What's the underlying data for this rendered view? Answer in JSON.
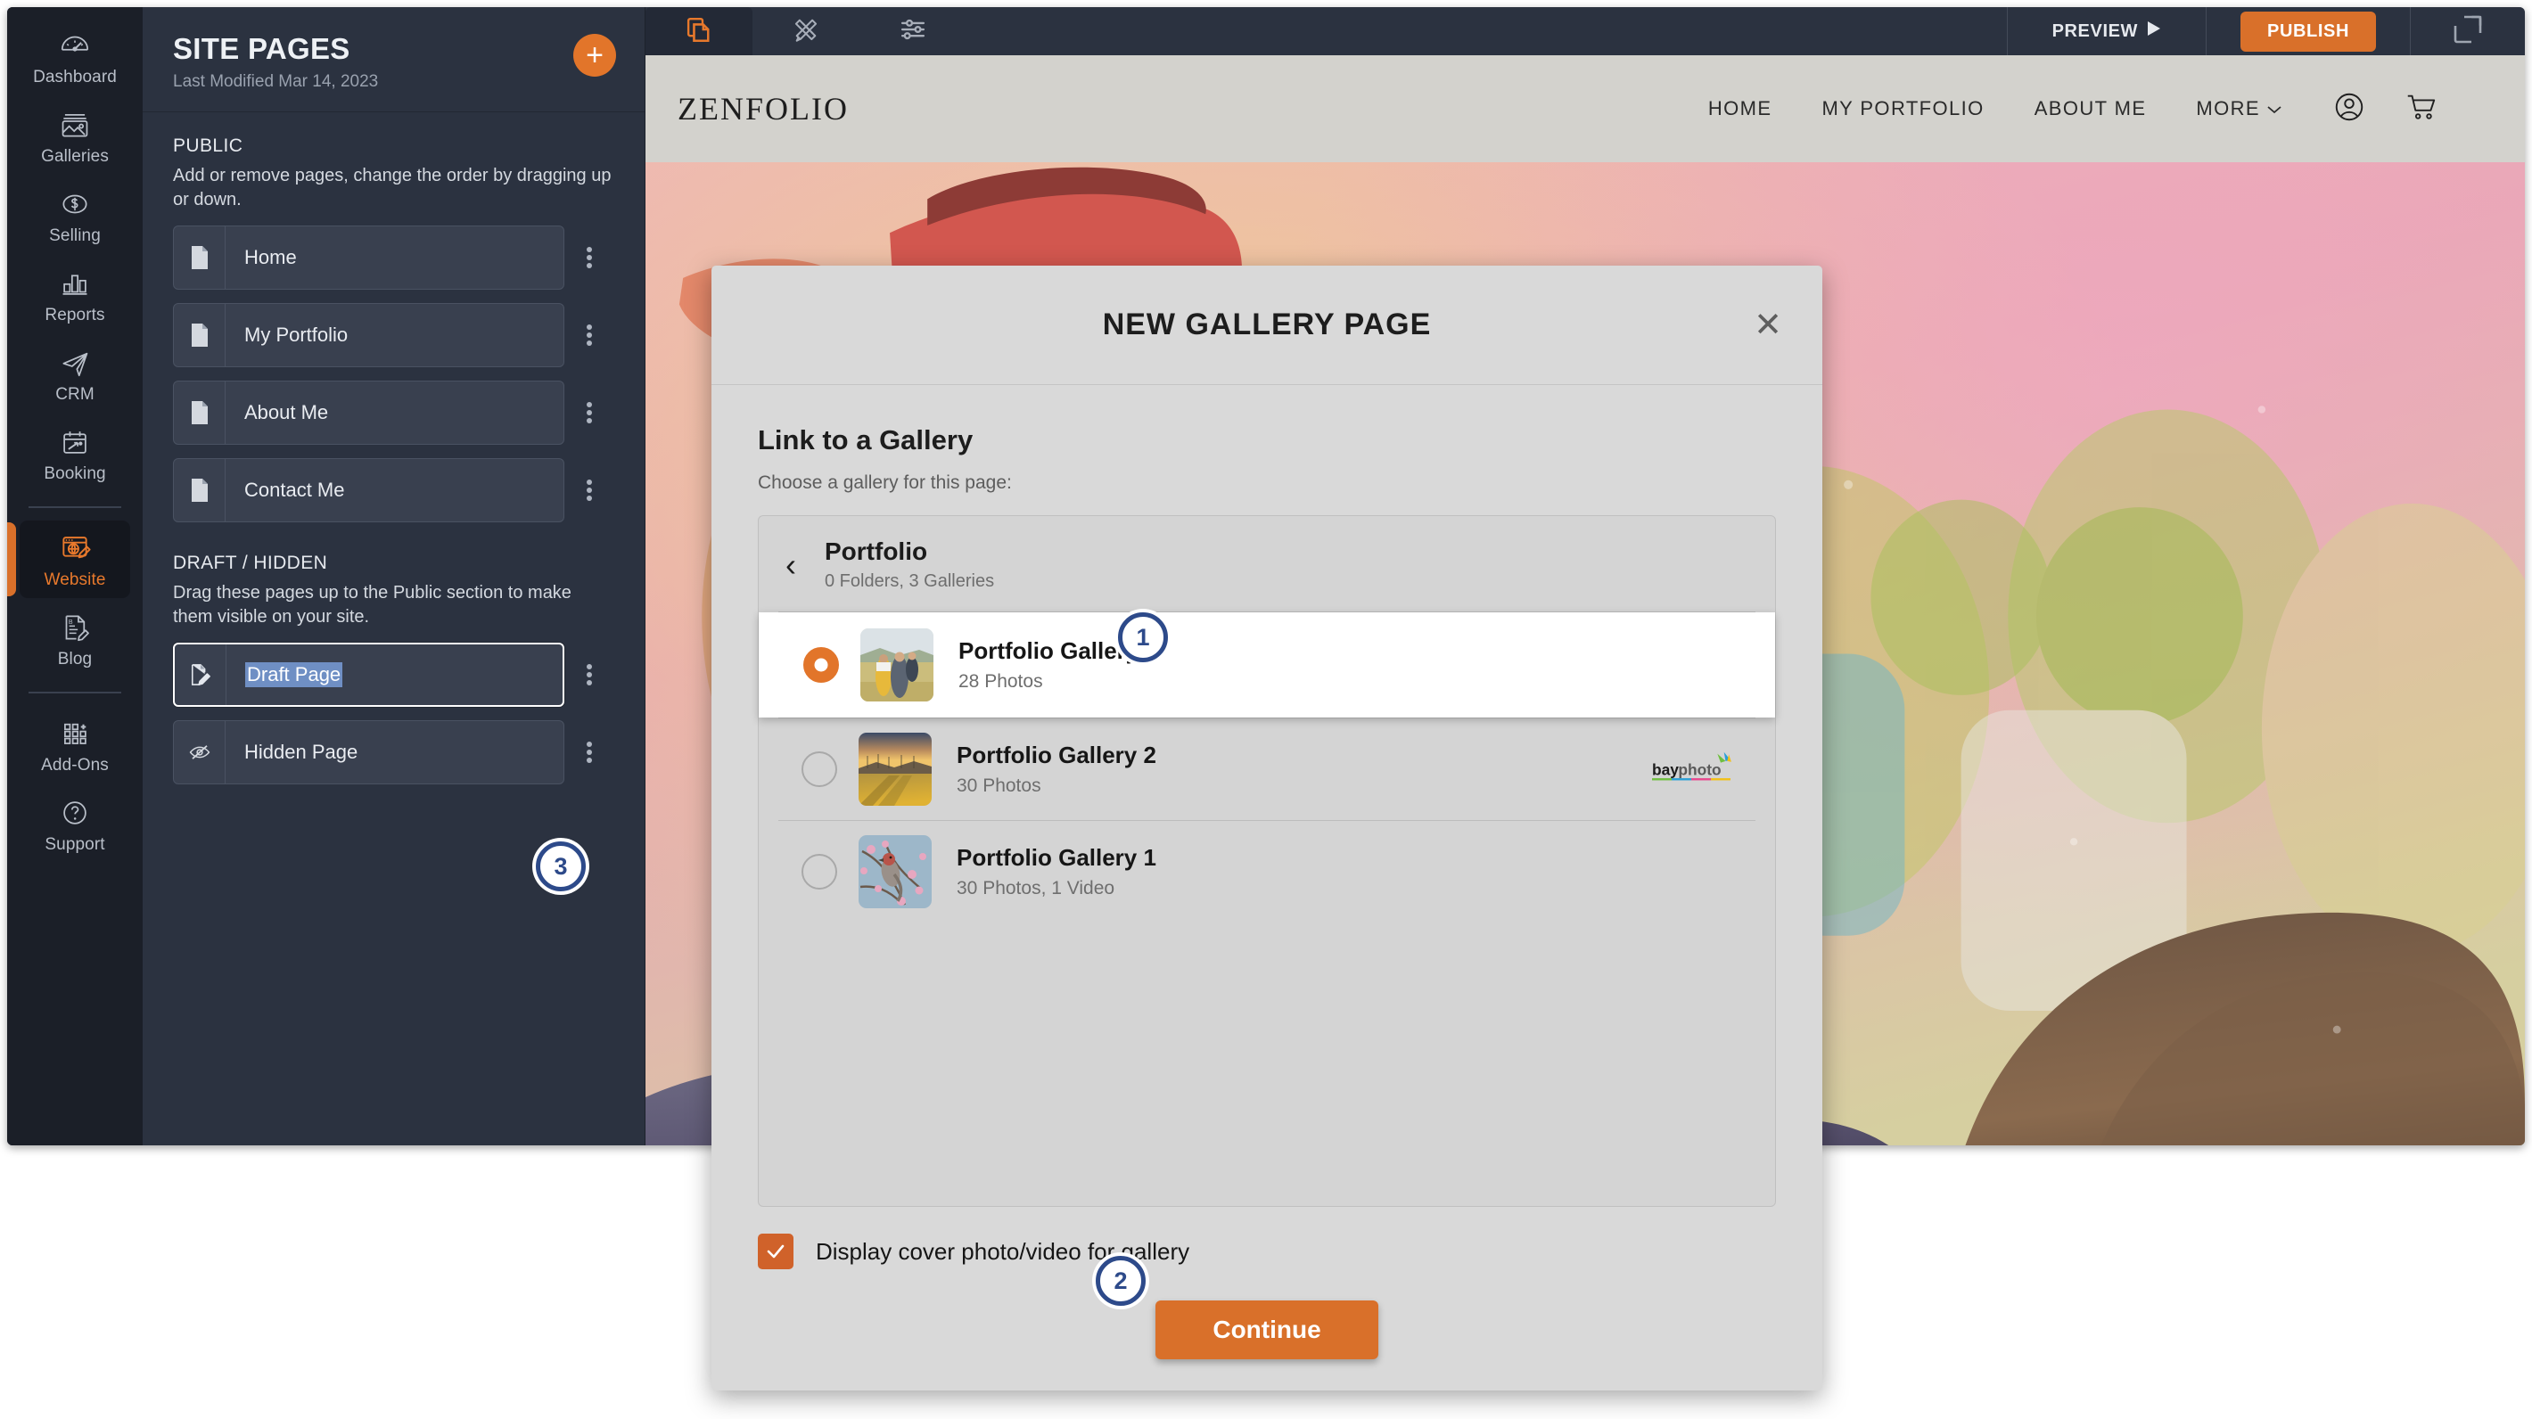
{
  "rail": {
    "items": [
      {
        "label": "Dashboard",
        "icon": "gauge-icon",
        "active": false
      },
      {
        "label": "Galleries",
        "icon": "photo-icon",
        "active": false
      },
      {
        "label": "Selling",
        "icon": "dollar-icon",
        "active": false
      },
      {
        "label": "Reports",
        "icon": "bar-chart-icon",
        "active": false
      },
      {
        "label": "CRM",
        "icon": "paper-plane-icon",
        "active": false
      },
      {
        "label": "Booking",
        "icon": "calendar-icon",
        "active": false
      },
      {
        "label": "Website",
        "icon": "website-edit-icon",
        "active": true
      },
      {
        "label": "Blog",
        "icon": "blog-pencil-icon",
        "active": false
      },
      {
        "label": "Add-Ons",
        "icon": "grid-plus-icon",
        "active": false
      },
      {
        "label": "Support",
        "icon": "question-circle-icon",
        "active": false
      }
    ]
  },
  "pages_panel": {
    "title": "SITE PAGES",
    "last_modified": "Last Modified Mar 14, 2023",
    "add_button_label": "+",
    "public": {
      "heading": "PUBLIC",
      "description": "Add or remove pages, change the order by dragging up or down.",
      "items": [
        {
          "label": "Home",
          "icon": "page-icon"
        },
        {
          "label": "My Portfolio",
          "icon": "page-icon"
        },
        {
          "label": "About Me",
          "icon": "page-icon"
        },
        {
          "label": "Contact Me",
          "icon": "page-icon"
        }
      ]
    },
    "draft": {
      "heading": "DRAFT / HIDDEN",
      "description": "Drag these pages up to the Public section to make them visible on your site.",
      "items": [
        {
          "label": "Draft Page",
          "icon": "draft-pencil-icon",
          "editing": true,
          "selected_text": true
        },
        {
          "label": "Hidden Page",
          "icon": "eye-off-icon",
          "editing": false,
          "selected_text": false
        }
      ]
    }
  },
  "toolbar": {
    "tabs": [
      {
        "name": "pages-tab",
        "icon": "pages-stack-icon",
        "active": true
      },
      {
        "name": "design-tab",
        "icon": "ruler-pencil-icon",
        "active": false
      },
      {
        "name": "settings-tab",
        "icon": "sliders-icon",
        "active": false
      }
    ],
    "preview_label": "PREVIEW",
    "preview_icon": "play-triangle-icon",
    "publish_label": "PUBLISH",
    "expand_icon": "expand-icon"
  },
  "site": {
    "brand": "ZENFOLIO",
    "nav": [
      {
        "label": "HOME"
      },
      {
        "label": "MY PORTFOLIO"
      },
      {
        "label": "ABOUT ME"
      },
      {
        "label": "MORE"
      }
    ],
    "more_caret": "⌄",
    "icons": [
      {
        "name": "account-icon"
      },
      {
        "name": "cart-icon"
      }
    ]
  },
  "modal": {
    "title": "NEW GALLERY PAGE",
    "close_label": "✕",
    "section_heading": "Link to a Gallery",
    "section_sub": "Choose a gallery for this page:",
    "breadcrumb": {
      "back_icon": "chevron-left-icon",
      "name": "Portfolio",
      "meta": "0 Folders, 3 Galleries"
    },
    "galleries": [
      {
        "name": "Portfolio Gallery 3",
        "meta": "28 Photos",
        "selected": true,
        "thumb": "family-field-thumb",
        "lab_logo": null
      },
      {
        "name": "Portfolio Gallery 2",
        "meta": "30 Photos",
        "selected": false,
        "thumb": "sunset-field-thumb",
        "lab_logo": "bayphoto"
      },
      {
        "name": "Portfolio Gallery 1",
        "meta": "30 Photos, 1 Video",
        "selected": false,
        "thumb": "bird-blossom-thumb",
        "lab_logo": null
      }
    ],
    "checkbox": {
      "label": "Display cover photo/video for gallery",
      "checked": true
    },
    "continue_label": "Continue"
  },
  "annotations": {
    "badges": [
      {
        "id": "1",
        "target": "selected-gallery-row"
      },
      {
        "id": "2",
        "target": "continue-button"
      },
      {
        "id": "3",
        "target": "draft-page-name-input"
      }
    ]
  },
  "colors": {
    "accent_orange": "#d9702a",
    "panel_dark": "#2b3240",
    "rail_dark": "#1b1f28",
    "badge_blue": "#2d4a8a",
    "selection_blue": "#6f8fc4"
  }
}
